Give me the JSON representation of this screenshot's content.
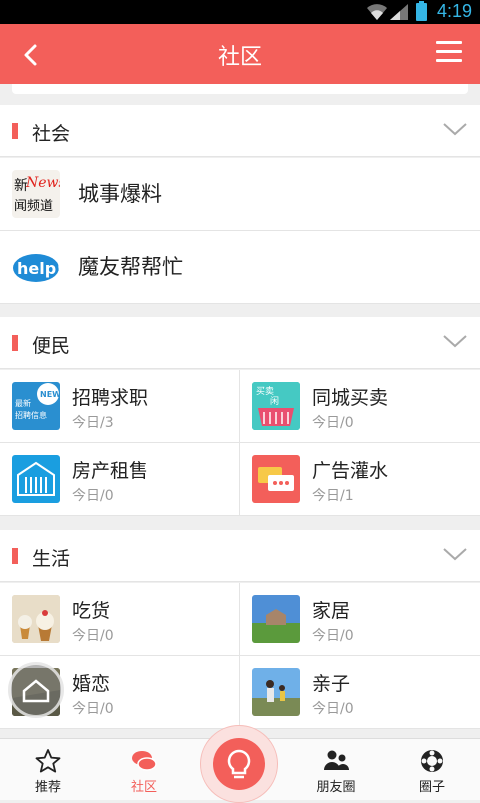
{
  "status_bar": {
    "time": "4:19"
  },
  "header": {
    "title": "社区"
  },
  "sections": [
    {
      "label": "社会",
      "items": [
        {
          "name": "城事爆料",
          "icon": "news-channel-icon"
        },
        {
          "name": "魔友帮帮忙",
          "icon": "help-icon"
        }
      ]
    },
    {
      "label": "便民",
      "items": [
        {
          "name": "招聘求职",
          "meta": "今日/3",
          "icon": "recruit-icon"
        },
        {
          "name": "同城买卖",
          "meta": "今日/0",
          "icon": "trade-basket-icon"
        },
        {
          "name": "房产租售",
          "meta": "今日/0",
          "icon": "house-icon"
        },
        {
          "name": "广告灌水",
          "meta": "今日/1",
          "icon": "chat-bubble-icon"
        }
      ]
    },
    {
      "label": "生活",
      "items": [
        {
          "name": "吃货",
          "meta": "今日/0",
          "icon": "cupcake-icon"
        },
        {
          "name": "家居",
          "meta": "今日/0",
          "icon": "home-photo-icon"
        },
        {
          "name": "婚恋",
          "meta": "今日/0",
          "icon": "love-photo-icon"
        },
        {
          "name": "亲子",
          "meta": "今日/0",
          "icon": "family-photo-icon"
        }
      ]
    }
  ],
  "icon_text": {
    "news": "News",
    "news_cn_a": "新",
    "news_cn_b": "闻频道",
    "help": "help!",
    "recruit_new": "NEW",
    "recruit_a": "最新",
    "recruit_b": "招聘信息",
    "trade_a": "买卖",
    "trade_b": "闲"
  },
  "tabs": [
    {
      "label": "推荐",
      "icon": "star-icon"
    },
    {
      "label": "社区",
      "icon": "chat-icon"
    },
    {
      "label": "朋友圈",
      "icon": "people-icon"
    },
    {
      "label": "圈子",
      "icon": "ring-icon"
    }
  ],
  "colors": {
    "accent": "#f35f5a",
    "status_blue": "#35b6e6"
  }
}
